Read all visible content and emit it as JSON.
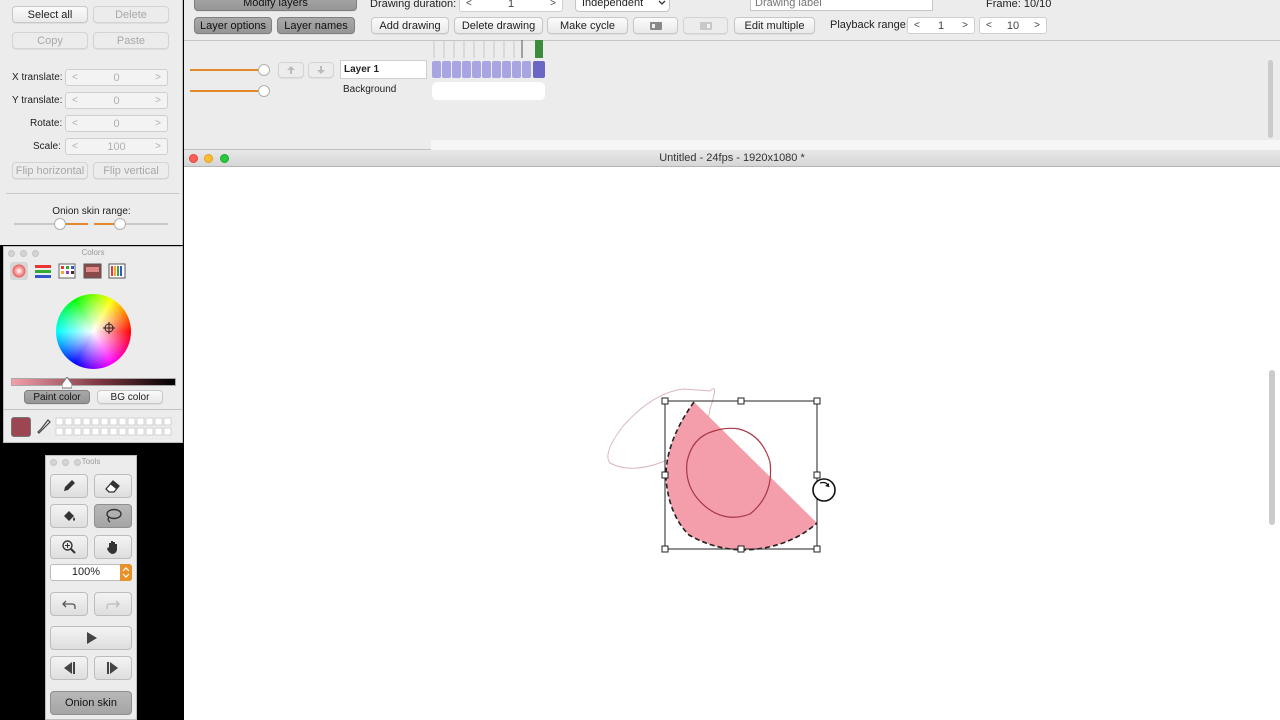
{
  "left": {
    "select_all": "Select all",
    "delete": "Delete",
    "copy": "Copy",
    "paste": "Paste",
    "x_translate_label": "X translate:",
    "x_translate": "0",
    "y_translate_label": "Y translate:",
    "y_translate": "0",
    "rotate_label": "Rotate:",
    "rotate": "0",
    "scale_label": "Scale:",
    "scale": "100",
    "flip_horizontal": "Flip horizontal",
    "flip_vertical": "Flip vertical",
    "onion_label": "Onion skin range:",
    "dec": "<",
    "inc": ">"
  },
  "colors": {
    "title": "Colors",
    "paint_color": "Paint color",
    "bg_color": "BG color",
    "current_color": "#9c4652"
  },
  "tools": {
    "title": "Tools",
    "zoom": "100%",
    "onion_skin": "Onion skin"
  },
  "toolbar": {
    "modify_layers": "Modify layers",
    "drawing_duration_label": "Drawing duration:",
    "drawing_duration": "1",
    "mode": "Independent",
    "drawing_label_placeholder": "Drawing label",
    "frame": "Frame: 10/10",
    "layer_options": "Layer options",
    "layer_names": "Layer names",
    "add_drawing": "Add drawing",
    "delete_drawing": "Delete drawing",
    "make_cycle": "Make cycle",
    "edit_multiple": "Edit multiple",
    "playback_label": "Playback range:",
    "playback_start": "1",
    "playback_end": "10"
  },
  "layers": [
    {
      "name": "Layer 1"
    },
    {
      "name": "Background"
    }
  ],
  "canvas": {
    "title": "Untitled - 24fps - 1920x1080 *"
  }
}
